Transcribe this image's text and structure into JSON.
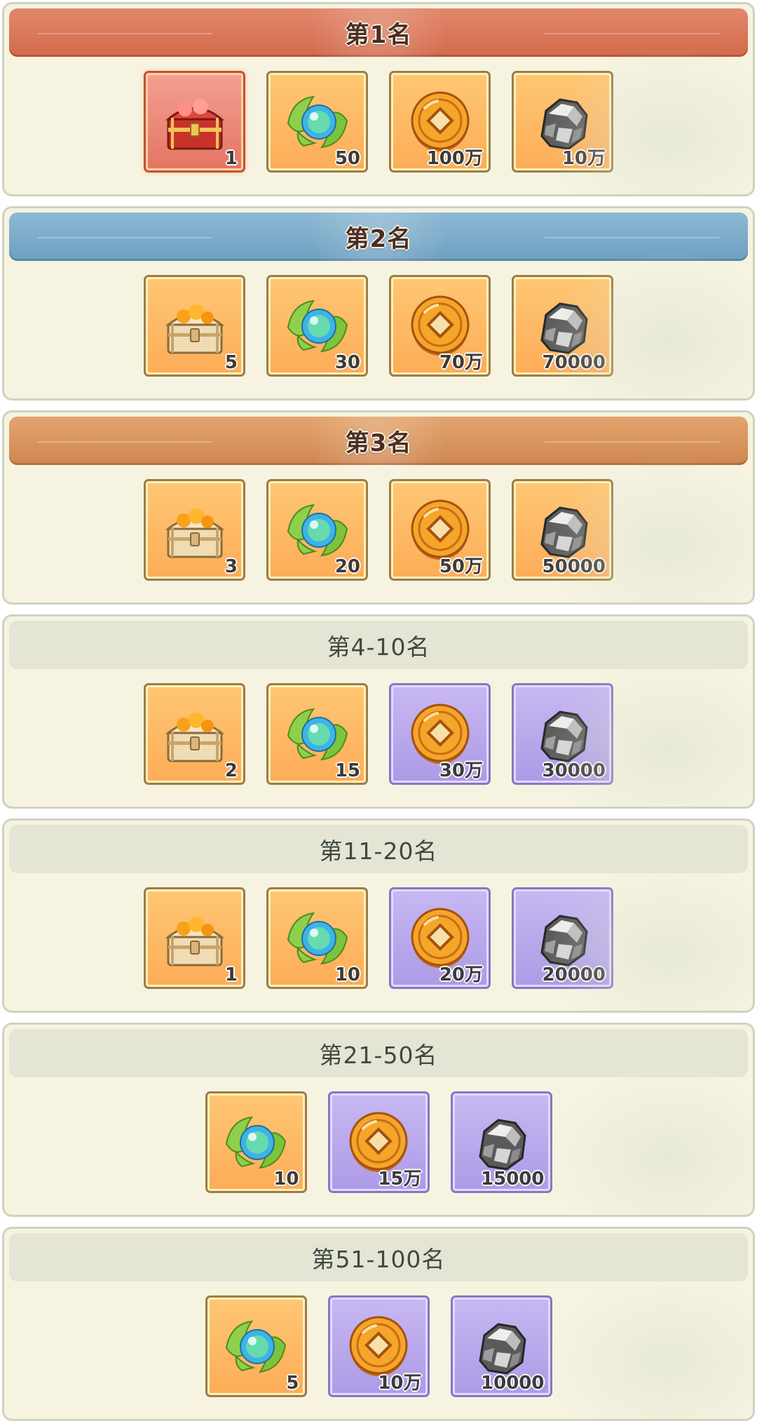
{
  "tiers": [
    {
      "title": "第1名",
      "style": "rank1",
      "items": [
        {
          "icon": "red-treasure-chest-icon",
          "bg": "red",
          "count": "1"
        },
        {
          "icon": "leaf-orb-icon",
          "bg": "orange",
          "count": "50"
        },
        {
          "icon": "copper-coin-icon",
          "bg": "orange",
          "count": "100万"
        },
        {
          "icon": "iron-ore-icon",
          "bg": "orange",
          "count": "10万"
        }
      ]
    },
    {
      "title": "第2名",
      "style": "rank2",
      "items": [
        {
          "icon": "gold-treasure-chest-icon",
          "bg": "orange",
          "count": "5"
        },
        {
          "icon": "leaf-orb-icon",
          "bg": "orange",
          "count": "30"
        },
        {
          "icon": "copper-coin-icon",
          "bg": "orange",
          "count": "70万"
        },
        {
          "icon": "iron-ore-icon",
          "bg": "orange",
          "count": "70000"
        }
      ]
    },
    {
      "title": "第3名",
      "style": "rank3",
      "items": [
        {
          "icon": "gold-treasure-chest-icon",
          "bg": "orange",
          "count": "3"
        },
        {
          "icon": "leaf-orb-icon",
          "bg": "orange",
          "count": "20"
        },
        {
          "icon": "copper-coin-icon",
          "bg": "orange",
          "count": "50万"
        },
        {
          "icon": "iron-ore-icon",
          "bg": "orange",
          "count": "50000"
        }
      ]
    },
    {
      "title": "第4-10名",
      "style": "plain",
      "items": [
        {
          "icon": "gold-treasure-chest-icon",
          "bg": "orange",
          "count": "2"
        },
        {
          "icon": "leaf-orb-icon",
          "bg": "orange",
          "count": "15"
        },
        {
          "icon": "copper-coin-icon",
          "bg": "purple",
          "count": "30万"
        },
        {
          "icon": "iron-ore-icon",
          "bg": "purple",
          "count": "30000"
        }
      ]
    },
    {
      "title": "第11-20名",
      "style": "plain",
      "items": [
        {
          "icon": "gold-treasure-chest-icon",
          "bg": "orange",
          "count": "1"
        },
        {
          "icon": "leaf-orb-icon",
          "bg": "orange",
          "count": "10"
        },
        {
          "icon": "copper-coin-icon",
          "bg": "purple",
          "count": "20万"
        },
        {
          "icon": "iron-ore-icon",
          "bg": "purple",
          "count": "20000"
        }
      ]
    },
    {
      "title": "第21-50名",
      "style": "plain",
      "items": [
        {
          "icon": "leaf-orb-icon",
          "bg": "orange",
          "count": "10"
        },
        {
          "icon": "copper-coin-icon",
          "bg": "purple",
          "count": "15万"
        },
        {
          "icon": "iron-ore-icon",
          "bg": "purple",
          "count": "15000"
        }
      ]
    },
    {
      "title": "第51-100名",
      "style": "plain",
      "items": [
        {
          "icon": "leaf-orb-icon",
          "bg": "orange",
          "count": "5"
        },
        {
          "icon": "copper-coin-icon",
          "bg": "purple",
          "count": "10万"
        },
        {
          "icon": "iron-ore-icon",
          "bg": "purple",
          "count": "10000"
        }
      ]
    }
  ]
}
